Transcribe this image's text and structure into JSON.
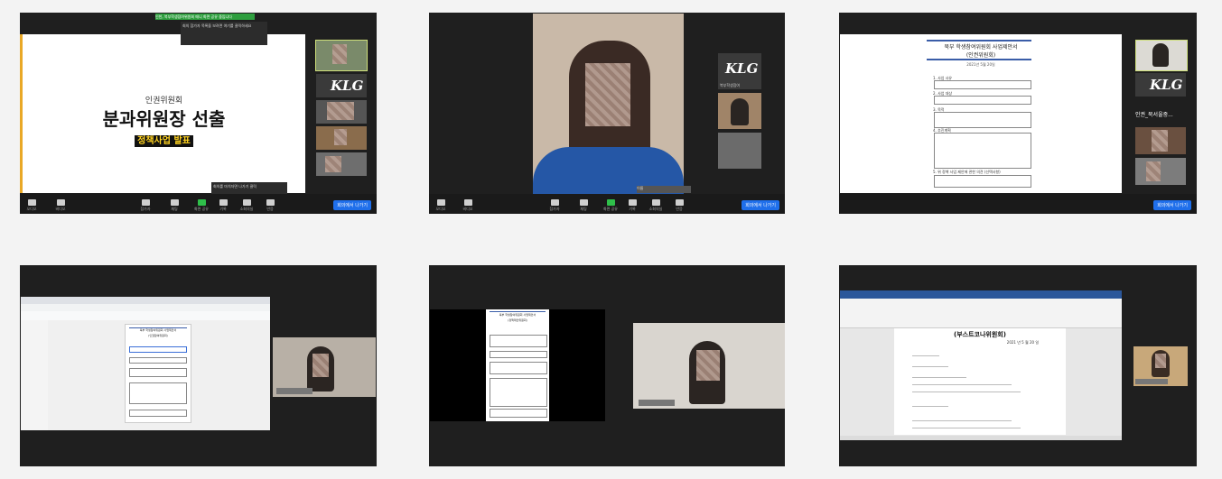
{
  "tile1": {
    "banner": "인천, 북부학생참여위원회 매니 화면 공유 중입니다",
    "slide_subtitle": "인권위원회",
    "slide_title": "분과위원장 선출",
    "slide_tag": "정책사업 발표",
    "tooltip": "회의 참가자 목록을 보려면 여기를 클릭하세요",
    "chat_preview": "회의를 마치자면 나가기 클릭",
    "end_label": "회의에서 나가기",
    "controls": [
      "오디오",
      "비디오",
      "참가자",
      "채팅",
      "화면 공유",
      "기록",
      "소회의실",
      "반응"
    ]
  },
  "tile2": {
    "name_label": "이름",
    "thumb_label_1": "북부학생참여",
    "end_label": "회의에서 나가기",
    "controls": [
      "오디오",
      "비디오",
      "참가자",
      "채팅",
      "화면 공유",
      "기록",
      "소회의실",
      "반응"
    ]
  },
  "tile3": {
    "doc_title": "북부 학생참여위원회 사업제안서",
    "doc_subtitle": "(인권위원회)",
    "doc_date": "2021년 5월 20일",
    "fields": [
      "1. 사업 사유",
      "2. 사업 대상",
      "3. 목적",
      "4. 추진계획",
      "5. 위 정책 사업 제안에 관한 의견 (선택사항)"
    ],
    "group_label": "인권_북서울중...",
    "end_label": "회의에서 나가기"
  },
  "tile4": {
    "doc_title": "북부 학생참여위원회 사업제안서",
    "doc_subtitle": "(인권참여위원회)"
  },
  "tile5": {
    "doc_title": "북부 학생참여위원회 사업제안서",
    "doc_subtitle": "(정책제안위원회)"
  },
  "tile6": {
    "doc_title": "(부스트코나위원회)",
    "doc_date": "2021 년 5 월 20 일"
  }
}
